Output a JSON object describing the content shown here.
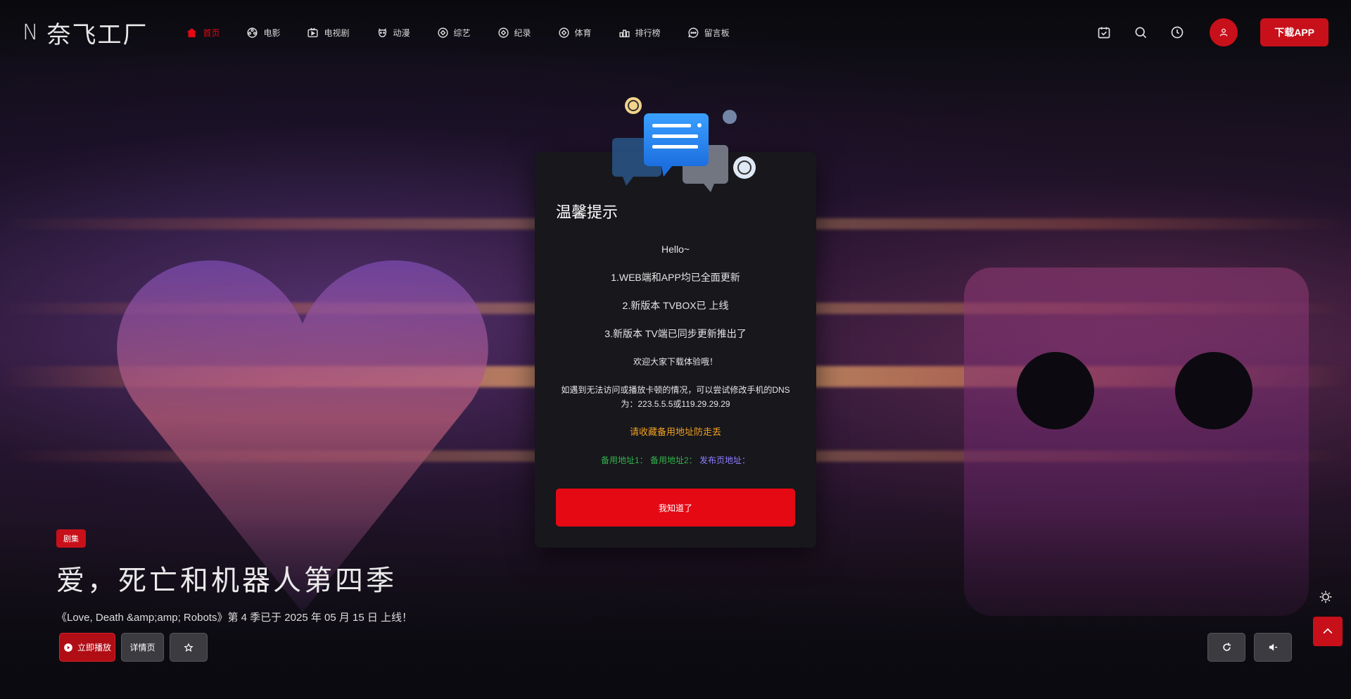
{
  "header": {
    "logo_letter": "N",
    "logo_text": "奈飞工厂",
    "nav": [
      {
        "label": "首页",
        "icon": "home-icon",
        "active": true
      },
      {
        "label": "电影",
        "icon": "film-reel-icon"
      },
      {
        "label": "电视剧",
        "icon": "tv-play-icon"
      },
      {
        "label": "动漫",
        "icon": "bear-face-icon"
      },
      {
        "label": "综艺",
        "icon": "badge-icon"
      },
      {
        "label": "纪录",
        "icon": "badge-icon"
      },
      {
        "label": "体育",
        "icon": "badge-icon"
      },
      {
        "label": "排行榜",
        "icon": "podium-icon"
      },
      {
        "label": "留言板",
        "icon": "chat-icon"
      }
    ],
    "app_button": "下载APP",
    "accent_color": "#c8101a"
  },
  "hero": {
    "tag": "剧集",
    "title": "爱，死亡和机器人第四季",
    "subtitle": "《Love, Death &amp;amp; Robots》第 4 季已于 2025 年 05 月 15 日 上线！",
    "play_button": "立即播放",
    "detail_button": "详情页"
  },
  "modal": {
    "title": "温馨提示",
    "lines": [
      "Hello~",
      "1.WEB端和APP均已全面更新",
      "2.新版本 TVBOX已 上线",
      "3.新版本 TV端已同步更新推出了",
      "欢迎大家下载体验哦！",
      "如遇到无法访问或播放卡顿的情况，可以尝试修改手机的DNS为：223.5.5.5或119.29.29.29"
    ],
    "notice": "请收藏备用地址防走丢",
    "link1": "备用地址1：",
    "link2": "备用地址2：",
    "link3": "发布页地址：",
    "button": "我知道了"
  }
}
